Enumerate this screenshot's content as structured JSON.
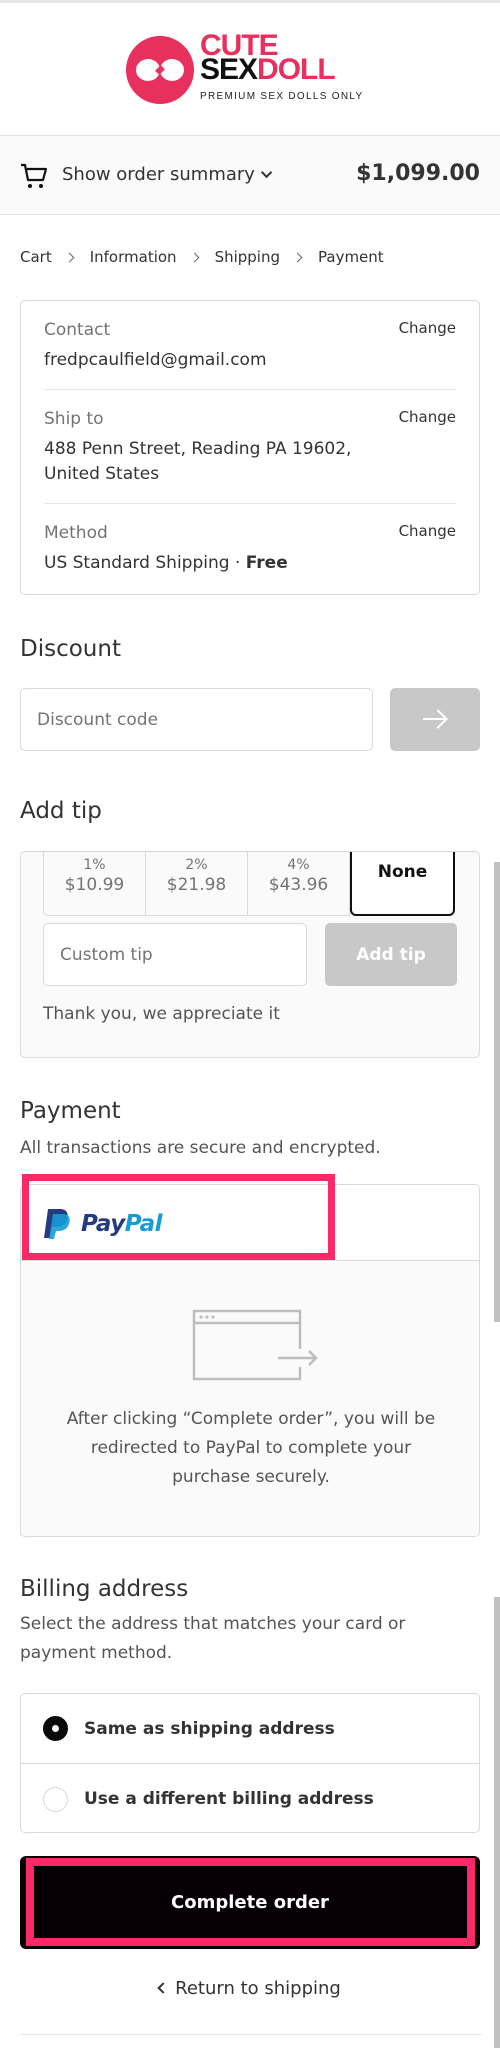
{
  "brand": {
    "name_line1": "CUTE",
    "name_sex": "SEX",
    "name_doll": "DOLL",
    "tagline": "PREMIUM SEX DOLLS ONLY",
    "accent_color": "#e8305e"
  },
  "order_summary": {
    "toggle_label": "Show order summary",
    "total": "$1,099.00",
    "icon": "cart-icon"
  },
  "breadcrumb": [
    {
      "label": "Cart"
    },
    {
      "label": "Information"
    },
    {
      "label": "Shipping"
    },
    {
      "label": "Payment",
      "current": true
    }
  ],
  "review": {
    "change_label": "Change",
    "rows": [
      {
        "label": "Contact",
        "value": "fredpcaulfield@gmail.com"
      },
      {
        "label": "Ship to",
        "value": "488 Penn Street, Reading PA 19602, United States"
      },
      {
        "label": "Method",
        "value": "US Standard Shipping · ",
        "value_bold": "Free"
      }
    ]
  },
  "discount": {
    "heading": "Discount",
    "placeholder": "Discount code",
    "submit_icon": "arrow-right-icon"
  },
  "tip": {
    "heading": "Add tip",
    "options": [
      {
        "percent": "1%",
        "amount": "$10.99"
      },
      {
        "percent": "2%",
        "amount": "$21.98"
      },
      {
        "percent": "4%",
        "amount": "$43.96"
      },
      {
        "label": "None",
        "selected": true
      }
    ],
    "custom_placeholder": "Custom tip",
    "add_label": "Add tip",
    "thanks": "Thank you, we appreciate it"
  },
  "payment": {
    "heading": "Payment",
    "subtitle": "All transactions are secure and encrypted.",
    "method_pay": "Pay",
    "method_pal": "Pal",
    "redirect_text": "After clicking “Complete order”, you will be redirected to PayPal to complete your purchase securely.",
    "paypal_colors": {
      "dark": "#253b80",
      "light": "#179bd7"
    }
  },
  "billing": {
    "heading": "Billing address",
    "subtitle": "Select the address that matches your card or payment method.",
    "options": [
      {
        "label": "Same as shipping address",
        "checked": true
      },
      {
        "label": "Use a different billing address",
        "checked": false
      }
    ]
  },
  "actions": {
    "complete_label": "Complete order",
    "return_label": "Return to shipping"
  },
  "annotation_color": "#fb2a66"
}
